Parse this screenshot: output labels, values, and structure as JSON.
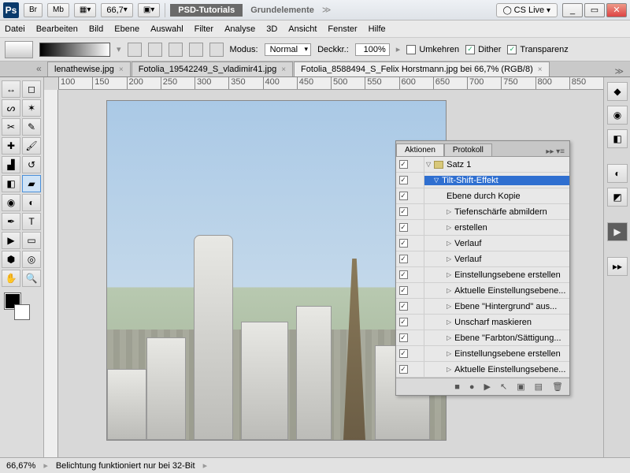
{
  "titlebar": {
    "br": "Br",
    "mb": "Mb",
    "zoom": "66,7",
    "psd": "PSD-Tutorials",
    "grund": "Grundelemente",
    "cslive": "CS Live"
  },
  "menu": [
    "Datei",
    "Bearbeiten",
    "Bild",
    "Ebene",
    "Auswahl",
    "Filter",
    "Analyse",
    "3D",
    "Ansicht",
    "Fenster",
    "Hilfe"
  ],
  "opt": {
    "modus_label": "Modus:",
    "modus_value": "Normal",
    "deck_label": "Deckkr.:",
    "deck_value": "100%",
    "umkehren": "Umkehren",
    "dither": "Dither",
    "transparenz": "Transparenz"
  },
  "tabs": [
    {
      "label": "lenathewise.jpg",
      "active": false
    },
    {
      "label": "Fotolia_19542249_S_vladimir41.jpg",
      "active": false
    },
    {
      "label": "Fotolia_8588494_S_Felix Horstmann.jpg bei 66,7% (RGB/8)",
      "active": true
    }
  ],
  "ruler": [
    "100",
    "150",
    "200",
    "250",
    "300",
    "350",
    "400",
    "450",
    "500",
    "550",
    "600",
    "650",
    "700",
    "750",
    "800",
    "850"
  ],
  "panel": {
    "tab1": "Aktionen",
    "tab2": "Protokoll",
    "set": "Satz 1",
    "action": "Tilt-Shift-Effekt",
    "steps": [
      "Ebene durch Kopie",
      "Tiefenschärfe abmildern",
      "erstellen",
      "Verlauf",
      "Verlauf",
      "Einstellungsebene erstellen",
      "Aktuelle Einstellungsebene...",
      "Ebene \"Hintergrund\" aus...",
      "Unscharf maskieren",
      "Ebene \"Farbton/Sättigung...",
      "Einstellungsebene erstellen",
      "Aktuelle Einstellungsebene..."
    ]
  },
  "status": {
    "zoom": "66,67%",
    "msg": "Belichtung funktioniert nur bei 32-Bit"
  }
}
